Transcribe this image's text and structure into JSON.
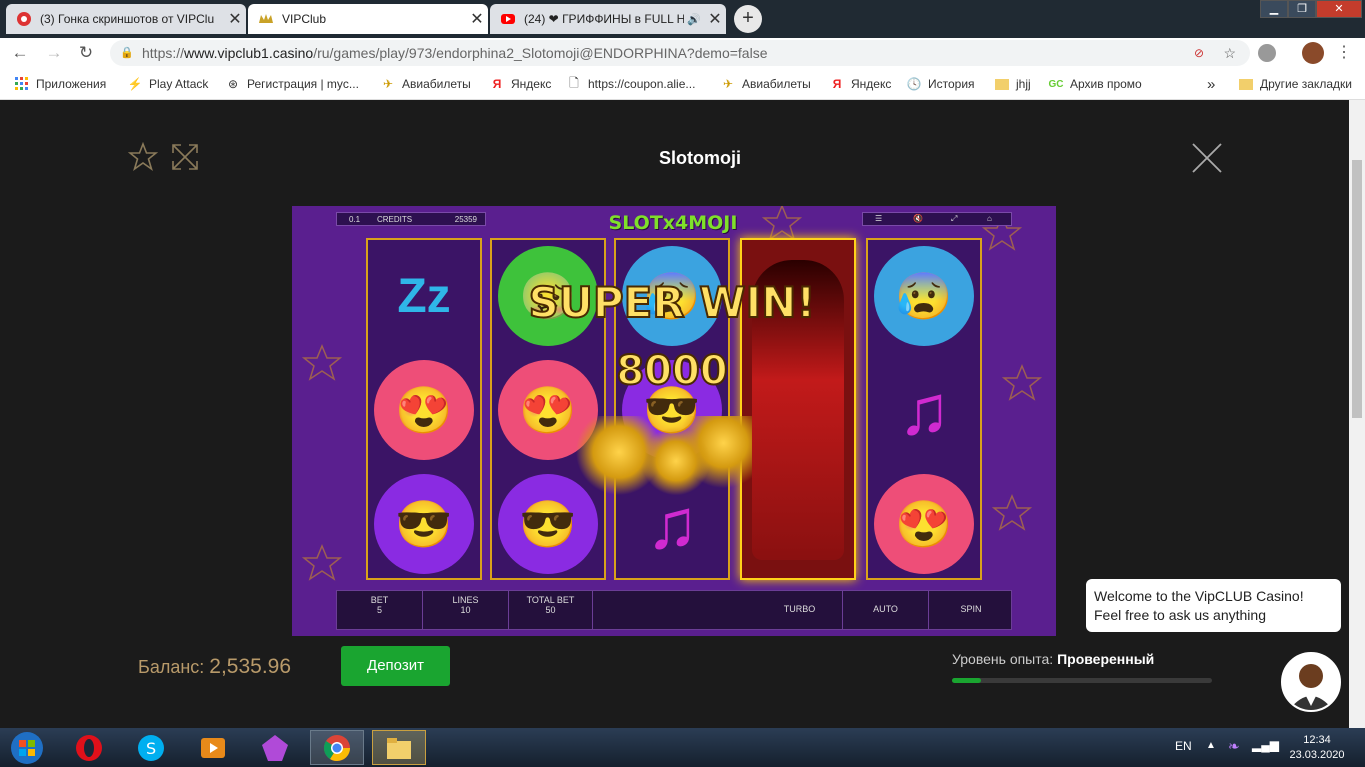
{
  "tabs": [
    {
      "title": "(3) Гонка скриншотов от VIPClu",
      "icon": "casino-icon"
    },
    {
      "title": "VIPClub",
      "icon": "crown-icon"
    },
    {
      "title": "(24) ❤ ГРИФФИНЫ в FULL H",
      "icon": "youtube-icon"
    }
  ],
  "address": {
    "protocol": "https://",
    "host": "www.vipclub1.casino",
    "path": "/ru/games/play/973/endorphina2_Slotomoji@ENDORPHINA?demo=false"
  },
  "bookmarks": [
    "Приложения",
    "Play Attack",
    "Регистрация | myc...",
    "Авиабилеты",
    "Яндекс",
    "https://coupon.alie...",
    "Авиабилеты",
    "Яндекс",
    "История",
    "jhjj",
    "Архив промо",
    "Другие закладки"
  ],
  "bookmarks_more": "»",
  "game": {
    "title": "Slotomoji",
    "logo": "SLOTx4MOJI",
    "denom": "0.1",
    "credits_label": "CREDITS",
    "credits_value": "25359",
    "win_text": "SUPER WIN!",
    "win_amount": "8000",
    "bet_label": "BET",
    "bet_value": "5",
    "lines_label": "LINES",
    "lines_value": "10",
    "total_bet_label": "TOTAL BET",
    "total_bet_value": "50",
    "turbo": "TURBO",
    "auto": "AUTO",
    "spin": "SPIN"
  },
  "balance": {
    "label": "Баланс:",
    "value": "2,535.96"
  },
  "deposit": "Депозит",
  "level": {
    "label": "Уровень опыта:",
    "value": "Проверенный",
    "progress": 0.11
  },
  "chat": {
    "line1": "Welcome to the VipCLUB Casino!",
    "line2": "Feel free to ask us anything"
  },
  "tray": {
    "lang": "EN",
    "time": "12:34",
    "date": "23.03.2020"
  },
  "colors": {
    "deposit": "#1aa530",
    "game_bg": "#5a1f8f",
    "reel_border": "#d9a21b"
  }
}
